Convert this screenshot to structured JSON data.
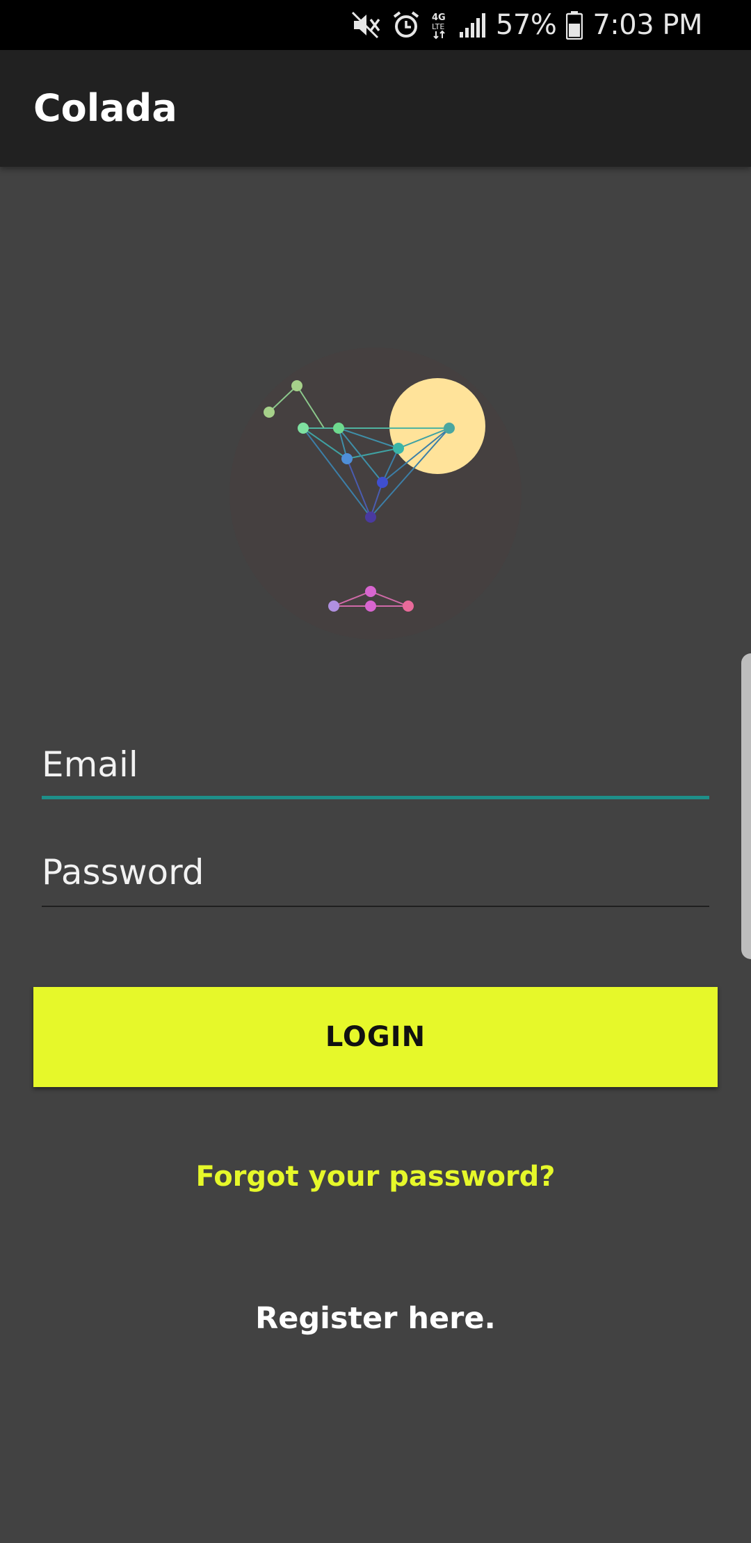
{
  "status_bar": {
    "battery_percent": "57%",
    "time": "7:03 PM",
    "icons": [
      "mute-icon",
      "alarm-icon",
      "lte-data-icon",
      "signal-icon",
      "battery-icon"
    ]
  },
  "app_bar": {
    "title": "Colada"
  },
  "logo": {
    "icon": "cocktail-glass-constellation-icon",
    "moon_color": "#ffe39a",
    "background_color": "#454040"
  },
  "form": {
    "email": {
      "value": "",
      "placeholder": "Email"
    },
    "password": {
      "value": "",
      "placeholder": "Password"
    },
    "login_label": "LOGIN",
    "forgot_label": "Forgot your password?",
    "register_label": "Register here."
  },
  "colors": {
    "accent": "#e6f82a",
    "focus_underline": "#1e8f89",
    "background": "#424242",
    "app_bar": "#212121"
  }
}
